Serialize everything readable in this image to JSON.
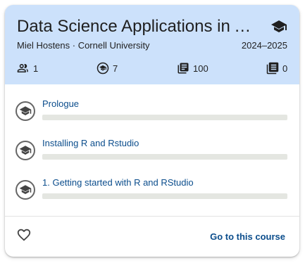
{
  "course": {
    "title": "Data Science Applications in Agriculture",
    "author_org": "Miel Hostens · Cornell University",
    "year": "2024–2025",
    "stats": {
      "people": "1",
      "lessons": "7",
      "content": "100",
      "documents": "0"
    }
  },
  "lessons": [
    {
      "title": "Prologue",
      "progress": 0
    },
    {
      "title": "Installing R and Rstudio",
      "progress": 0
    },
    {
      "title": "1. Getting started with R and RStudio",
      "progress": 0
    }
  ],
  "footer": {
    "go_label": "Go to this course"
  },
  "colors": {
    "header_bg": "#cce1fb",
    "link": "#0b4d8c",
    "track": "#e4e6e1"
  }
}
